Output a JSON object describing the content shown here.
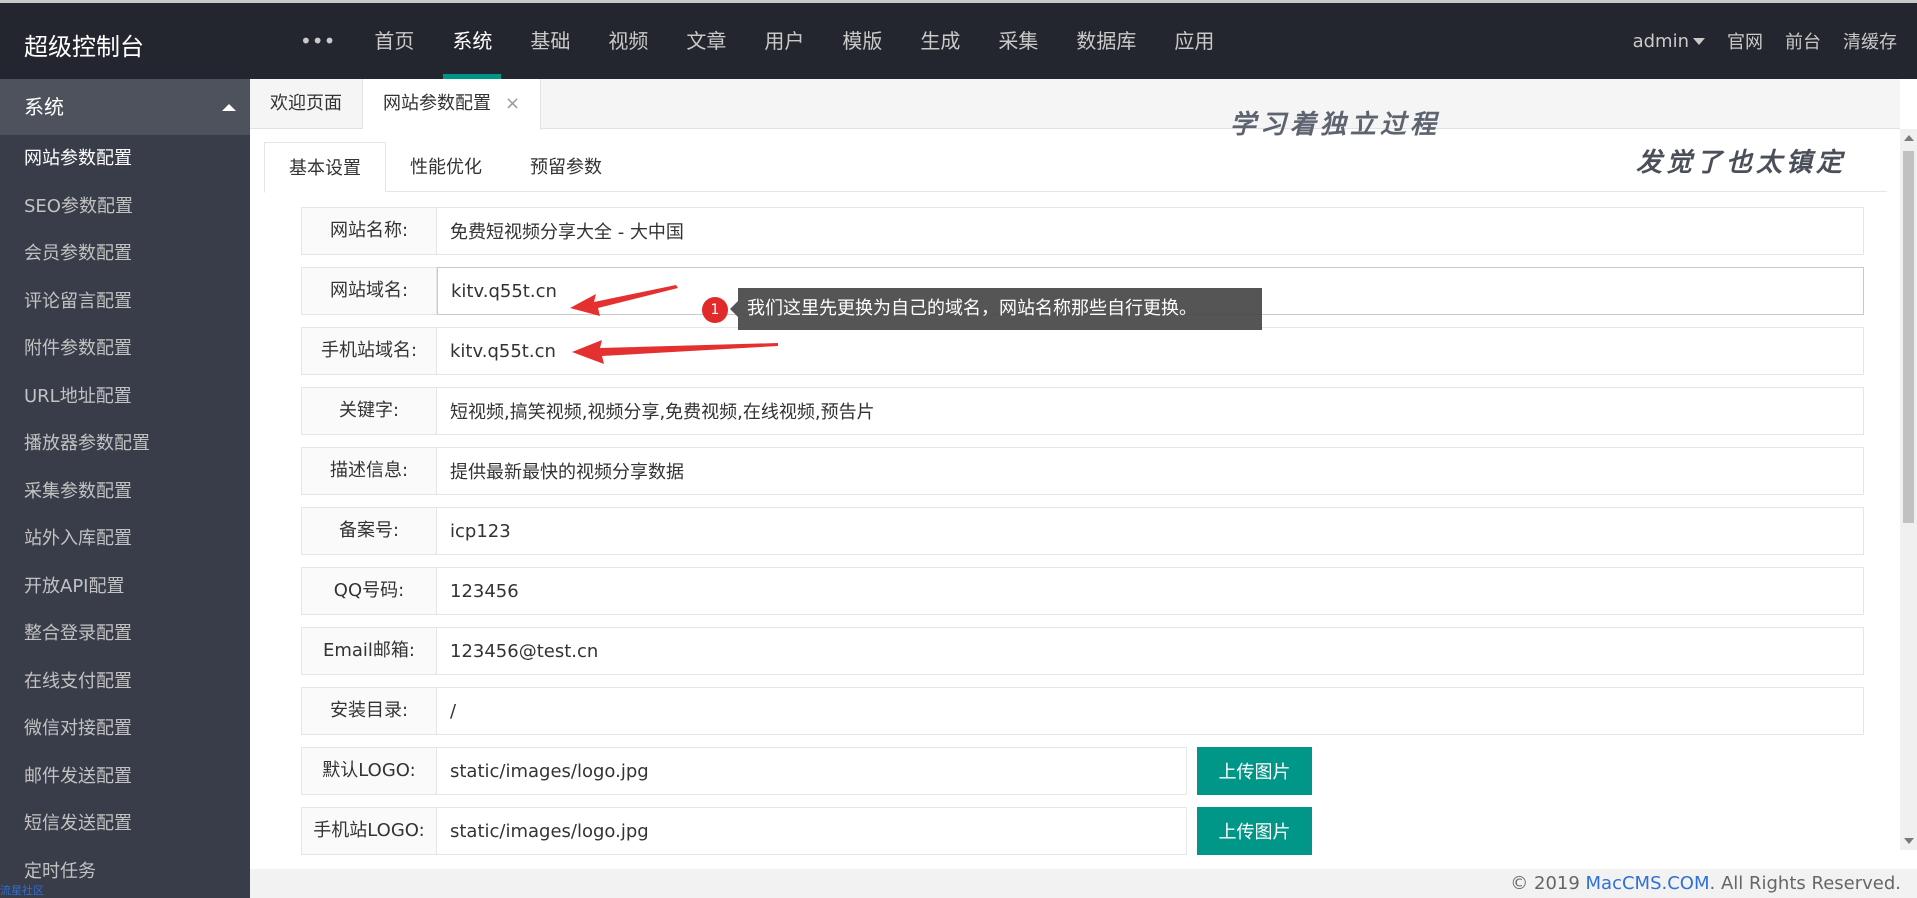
{
  "header": {
    "brand": "超级控制台",
    "more": "•••",
    "nav": [
      "首页",
      "系统",
      "基础",
      "视频",
      "文章",
      "用户",
      "模版",
      "生成",
      "采集",
      "数据库",
      "应用"
    ],
    "user": "admin",
    "links": [
      "官网",
      "前台",
      "清缓存"
    ]
  },
  "sidebar": {
    "section": "系统",
    "items": [
      "网站参数配置",
      "SEO参数配置",
      "会员参数配置",
      "评论留言配置",
      "附件参数配置",
      "URL地址配置",
      "播放器参数配置",
      "采集参数配置",
      "站外入库配置",
      "开放API配置",
      "整合登录配置",
      "在线支付配置",
      "微信对接配置",
      "邮件发送配置",
      "短信发送配置",
      "定时任务"
    ],
    "watermark": "流星社区"
  },
  "page_tabs": {
    "welcome": "欢迎页面",
    "current": "网站参数配置",
    "close": "×"
  },
  "inner_tabs": [
    "基本设置",
    "性能优化",
    "预留参数"
  ],
  "form": {
    "site_name": {
      "label": "网站名称:",
      "value": "免费短视频分享大全 - 大中国"
    },
    "site_domain": {
      "label": "网站域名:",
      "value": "kitv.q55t.cn"
    },
    "mobile_domain": {
      "label": "手机站域名:",
      "value": "kitv.q55t.cn"
    },
    "keywords": {
      "label": "关键字:",
      "value": "短视频,搞笑视频,视频分享,免费视频,在线视频,预告片"
    },
    "description": {
      "label": "描述信息:",
      "value": "提供最新最快的视频分享数据"
    },
    "icp": {
      "label": "备案号:",
      "value": "icp123"
    },
    "qq": {
      "label": "QQ号码:",
      "value": "123456"
    },
    "email": {
      "label": "Email邮箱:",
      "value": "123456@test.cn"
    },
    "install_dir": {
      "label": "安装目录:",
      "value": "/"
    },
    "logo": {
      "label": "默认LOGO:",
      "value": "static/images/logo.jpg"
    },
    "mobile_logo": {
      "label": "手机站LOGO:",
      "value": "static/images/logo.jpg"
    },
    "upload_label": "上传图片"
  },
  "annotation": {
    "badge": "1",
    "tip": "我们这里先更换为自己的域名，网站名称那些自行更换。",
    "hand1": "学习着独立过程",
    "hand2": "发觉了也太镇定",
    "arrow_color": "#e53030"
  },
  "footer": {
    "prefix": "© 2019 ",
    "link": "MacCMS.COM",
    "suffix": ". All Rights Reserved."
  },
  "colors": {
    "header_bg": "#23262e",
    "sidebar_bg": "#393d49",
    "accent": "#009688"
  }
}
